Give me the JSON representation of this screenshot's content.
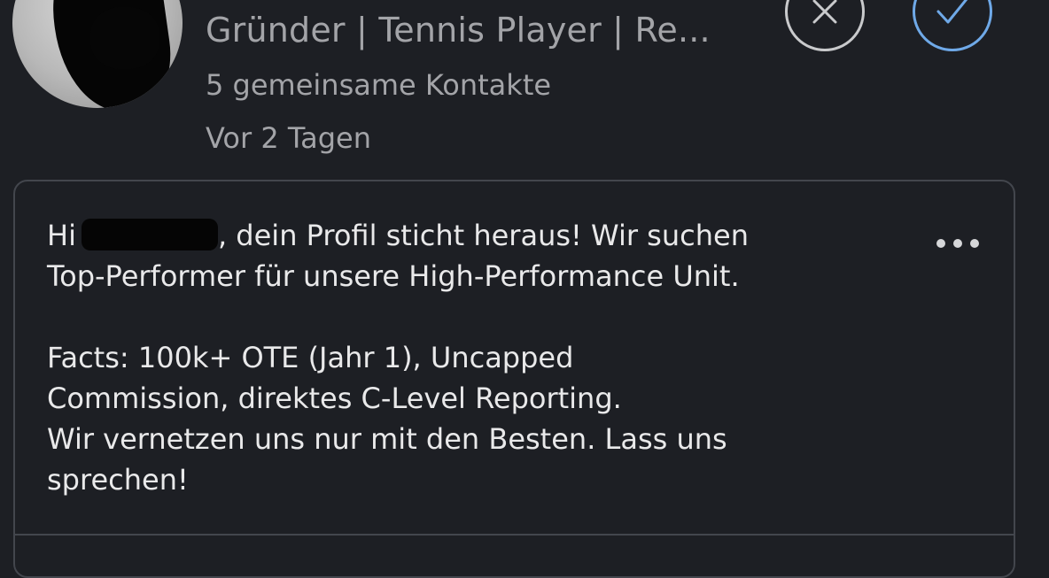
{
  "invitation": {
    "headline": "Gründer | Tennis Player | Re...",
    "mutual_connections": "5 gemeinsame Kontakte",
    "time_ago": "Vor 2 Tagen",
    "actions": {
      "ignore_icon": "close-icon",
      "accept_icon": "checkmark-icon",
      "ignore_color": "#c9cacc",
      "accept_color": "#6fa9e8"
    }
  },
  "message": {
    "greeting_prefix": "Hi",
    "line1_after_name": ", dein Profil sticht heraus! Wir suchen",
    "line2": "Top-Performer für unsere High-Performance Unit.",
    "facts_line1": "Facts: 100k+ OTE (Jahr 1), Uncapped",
    "facts_line2": "Commission, direktes C-Level Reporting.",
    "closing_line1": "Wir vernetzen uns nur mit den Besten. Lass uns",
    "closing_line2": "sprechen!",
    "more_icon": "more-horizontal-icon"
  }
}
